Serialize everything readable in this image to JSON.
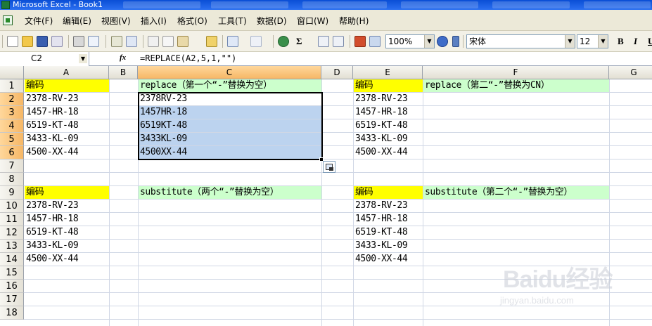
{
  "window": {
    "title": "Microsoft Excel - Book1"
  },
  "menu": [
    "文件(F)",
    "编辑(E)",
    "视图(V)",
    "插入(I)",
    "格式(O)",
    "工具(T)",
    "数据(D)",
    "窗口(W)",
    "帮助(H)"
  ],
  "toolbar": {
    "zoom": "100%",
    "font": "宋体",
    "font_size": "12",
    "bold": "B",
    "italic": "I",
    "underline": "U"
  },
  "formula_bar": {
    "name_box": "C2",
    "fx": "fx",
    "formula": "=REPLACE(A2,5,1,\"\")"
  },
  "columns": [
    "A",
    "B",
    "C",
    "D",
    "E",
    "F",
    "G"
  ],
  "rows": [
    "1",
    "2",
    "3",
    "4",
    "5",
    "6",
    "7",
    "8",
    "9",
    "10",
    "11",
    "12",
    "13",
    "14",
    "15",
    "16",
    "17",
    "18"
  ],
  "cells": {
    "A1": "编码",
    "C1": "replace（第一个“-”替换为空）",
    "E1": "编码",
    "F1": "replace（第二“-”替换为CN）",
    "A2": "2378-RV-23",
    "A3": "1457-HR-18",
    "A4": "6519-KT-48",
    "A5": "3433-KL-09",
    "A6": "4500-XX-44",
    "C2": "2378RV-23",
    "C3": "1457HR-18",
    "C4": "6519KT-48",
    "C5": "3433KL-09",
    "C6": "4500XX-44",
    "E2": "2378-RV-23",
    "E3": "1457-HR-18",
    "E4": "6519-KT-48",
    "E5": "3433-KL-09",
    "E6": "4500-XX-44",
    "A9": "编码",
    "C9": "substitute（两个“-”替换为空）",
    "E9": "编码",
    "F9": "substitute（第二个“-”替换为空）",
    "A10": "2378-RV-23",
    "A11": "1457-HR-18",
    "A12": "6519-KT-48",
    "A13": "3433-KL-09",
    "A14": "4500-XX-44",
    "E10": "2378-RV-23",
    "E11": "1457-HR-18",
    "E12": "6519-KT-48",
    "E13": "3433-KL-09",
    "E14": "4500-XX-44"
  },
  "watermark": {
    "brand": "Baidu经验",
    "url": "jingyan.baidu.com"
  },
  "colors": {
    "header_yellow": "#ffff00",
    "header_green": "#ccffcc",
    "selection": "#bcd3ef",
    "active_header": "#f6b766"
  },
  "selection": {
    "active_cell": "C2",
    "range": "C2:C6"
  }
}
